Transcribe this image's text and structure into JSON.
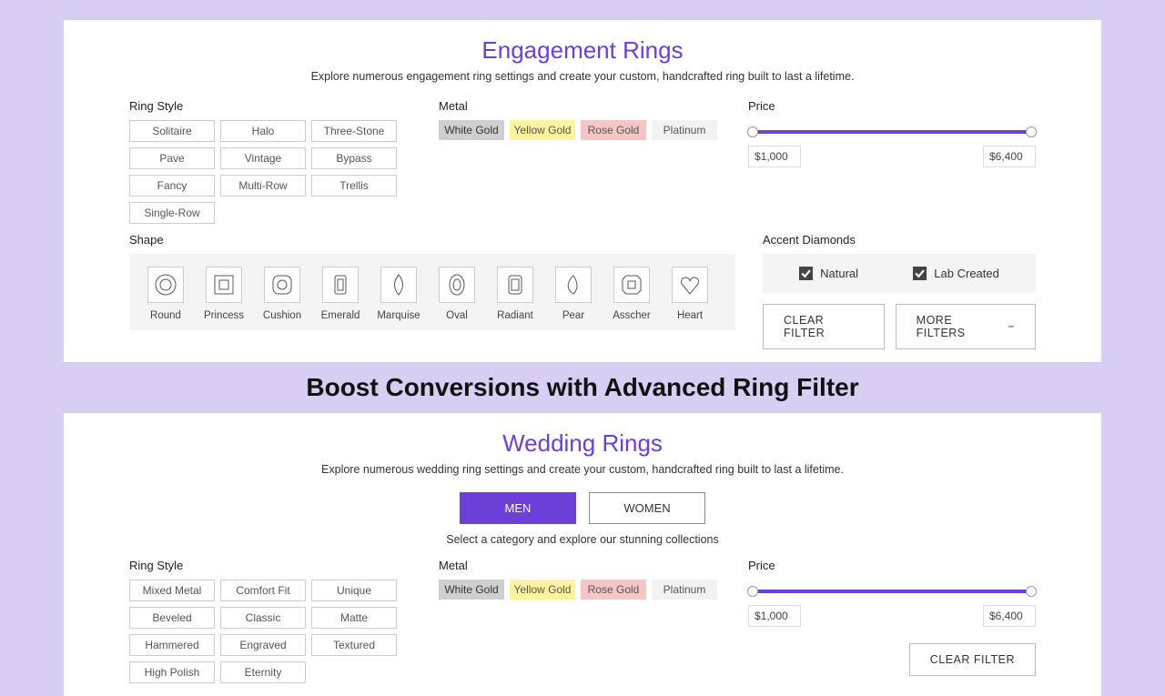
{
  "engagement": {
    "title": "Engagement Rings",
    "subtitle": "Explore numerous engagement ring settings and create your custom, handcrafted ring built to last a lifetime.",
    "ring_style_label": "Ring Style",
    "ring_styles": [
      "Solitaire",
      "Halo",
      "Three-Stone",
      "Pave",
      "Vintage",
      "Bypass",
      "Fancy",
      "Multi-Row",
      "Trellis",
      "Single-Row"
    ],
    "metal_label": "Metal",
    "metals": [
      "White Gold",
      "Yellow Gold",
      "Rose Gold",
      "Platinum"
    ],
    "price_label": "Price",
    "price_min": "$1,000",
    "price_max": "$6,400",
    "shape_label": "Shape",
    "shapes": [
      "Round",
      "Princess",
      "Cushion",
      "Emerald",
      "Marquise",
      "Oval",
      "Radiant",
      "Pear",
      "Asscher",
      "Heart"
    ],
    "accent_label": "Accent Diamonds",
    "accent_natural": "Natural",
    "accent_lab": "Lab Created",
    "clear_filter": "CLEAR FILTER",
    "more_filters": "MORE FILTERS"
  },
  "headline": "Boost Conversions with Advanced Ring Filter",
  "wedding": {
    "title": "Wedding Rings",
    "subtitle": "Explore numerous wedding ring settings and create your custom, handcrafted ring built to last a lifetime.",
    "cat_men": "MEN",
    "cat_women": "WOMEN",
    "cat_note": "Select a category and explore our stunning collections",
    "ring_style_label": "Ring Style",
    "ring_styles": [
      "Mixed Metal",
      "Comfort Fit",
      "Unique",
      "Beveled",
      "Classic",
      "Matte",
      "Hammered",
      "Engraved",
      "Textured",
      "High Polish",
      "Eternity"
    ],
    "metal_label": "Metal",
    "metals": [
      "White Gold",
      "Yellow Gold",
      "Rose Gold",
      "Platinum"
    ],
    "price_label": "Price",
    "price_min": "$1,000",
    "price_max": "$6,400",
    "clear_filter": "CLEAR FILTER"
  }
}
